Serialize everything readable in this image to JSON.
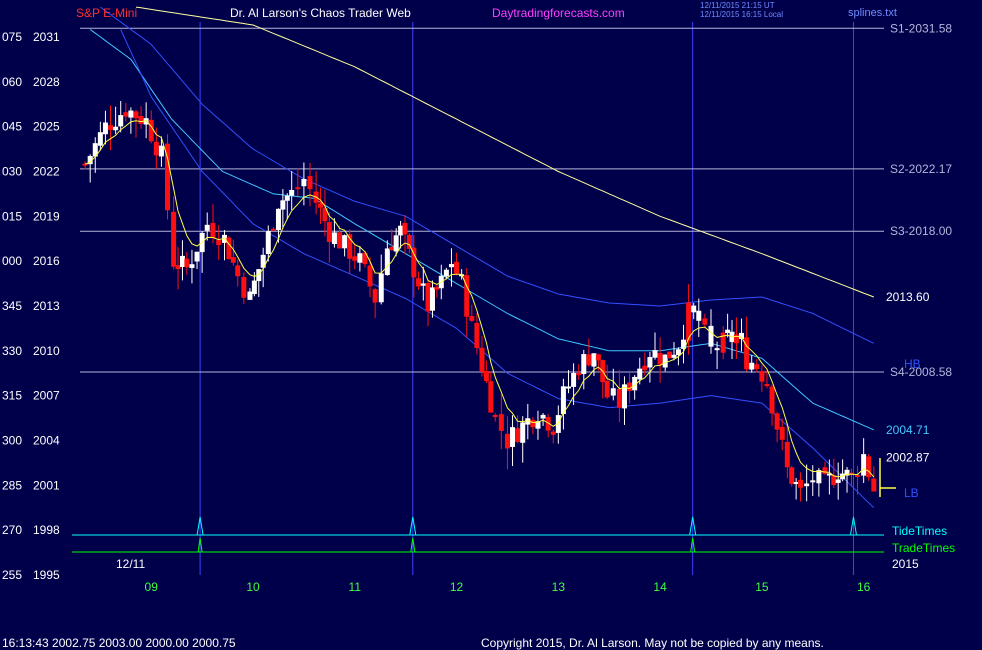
{
  "header": {
    "symbol": "S&P E-Mini",
    "site_title": "Dr. Al Larson's Chaos Trader Web",
    "website": "Daytradingforecasts.com",
    "timestamp_utc": "12/11/2015 21:15 UT",
    "timestamp_local": "12/11/2015 16:15 Local",
    "file": "splines.txt"
  },
  "footer": {
    "quote": "16:13:43  2002.75 2003.00 2000.00 2000.75",
    "copyright": "Copyright 2015, Dr. Al Larson. May not be copied by any means."
  },
  "labels": {
    "date": "12/11",
    "year": "2015",
    "tide_times": "TideTimes",
    "trade_times": "TradeTimes",
    "hb": "HB",
    "lb": "LB"
  },
  "colors": {
    "background": "#00004a",
    "up_candle": "#ffffff",
    "down_candle": "#ff1010",
    "ema_fast": "#ffff40",
    "ema_slow": "#ffffa0",
    "band_mid": "#40c8ff",
    "band_outer": "#3050ff",
    "levels": "#b4b4dc",
    "time_grid": "#4040ff",
    "tide": "#00ffff",
    "trade": "#00ff00"
  },
  "chart_data": {
    "type": "candlestick",
    "x_label": "hour",
    "xlim": [
      8.3,
      16.2
    ],
    "ylim": [
      1995,
      2032
    ],
    "x_ticks": [
      "09",
      "10",
      "11",
      "12",
      "13",
      "14",
      "15",
      "16"
    ],
    "y_ticks": [
      {
        "left": "255",
        "value": "1995"
      },
      {
        "left": "270",
        "value": "1998"
      },
      {
        "left": "285",
        "value": "2001"
      },
      {
        "left": "300",
        "value": "2004"
      },
      {
        "left": "315",
        "value": "2007"
      },
      {
        "left": "330",
        "value": "2010"
      },
      {
        "left": "345",
        "value": "2013"
      },
      {
        "left": "000",
        "value": "2016"
      },
      {
        "left": "015",
        "value": "2019"
      },
      {
        "left": "030",
        "value": "2022"
      },
      {
        "left": "045",
        "value": "2025"
      },
      {
        "left": "060",
        "value": "2028"
      },
      {
        "left": "075",
        "value": "2031"
      }
    ],
    "levels": [
      {
        "label": "S1-2031.58",
        "value": 2031.58
      },
      {
        "label": "S2-2022.17",
        "value": 2022.17
      },
      {
        "label": "S3-2018.00",
        "value": 2018.0
      },
      {
        "label": "S4-2008.58",
        "value": 2008.58
      }
    ],
    "line_labels": [
      {
        "label": "2013.60",
        "value": 2013.6
      },
      {
        "label": "2004.71",
        "value": 2004.71
      },
      {
        "label": "2002.87",
        "value": 2002.87
      }
    ],
    "time_lines": [
      9.48,
      11.57,
      14.32,
      15.9
    ],
    "tide_times": [
      9.48,
      11.57,
      14.32,
      15.9
    ],
    "trade_times": [
      9.48,
      11.57,
      14.32
    ],
    "price_path": [
      [
        8.35,
        2022.5
      ],
      [
        8.55,
        2025.0
      ],
      [
        8.75,
        2026.2
      ],
      [
        8.95,
        2025.4
      ],
      [
        9.1,
        2023.0
      ],
      [
        9.22,
        2016.0
      ],
      [
        9.35,
        2015.5
      ],
      [
        9.55,
        2018.5
      ],
      [
        9.72,
        2017.5
      ],
      [
        9.85,
        2015.0
      ],
      [
        9.97,
        2013.5
      ],
      [
        10.1,
        2016.5
      ],
      [
        10.25,
        2020.0
      ],
      [
        10.38,
        2020.5
      ],
      [
        10.5,
        2021.5
      ],
      [
        10.62,
        2020.0
      ],
      [
        10.75,
        2018.0
      ],
      [
        10.9,
        2017.0
      ],
      [
        11.05,
        2016.0
      ],
      [
        11.2,
        2013.5
      ],
      [
        11.32,
        2017.0
      ],
      [
        11.45,
        2018.0
      ],
      [
        11.58,
        2015.5
      ],
      [
        11.72,
        2013.0
      ],
      [
        11.85,
        2014.5
      ],
      [
        11.95,
        2016.0
      ],
      [
        12.05,
        2014.5
      ],
      [
        12.15,
        2011.5
      ],
      [
        12.25,
        2009.0
      ],
      [
        12.38,
        2005.5
      ],
      [
        12.5,
        2004.0
      ],
      [
        12.65,
        2005.0
      ],
      [
        12.8,
        2006.0
      ],
      [
        12.95,
        2005.0
      ],
      [
        13.05,
        2007.0
      ],
      [
        13.2,
        2009.0
      ],
      [
        13.35,
        2010.0
      ],
      [
        13.48,
        2007.0
      ],
      [
        13.6,
        2006.5
      ],
      [
        13.75,
        2008.5
      ],
      [
        13.9,
        2010.0
      ],
      [
        14.05,
        2009.5
      ],
      [
        14.18,
        2010.5
      ],
      [
        14.28,
        2012.5
      ],
      [
        14.38,
        2012.0
      ],
      [
        14.5,
        2010.0
      ],
      [
        14.62,
        2010.5
      ],
      [
        14.75,
        2011.0
      ],
      [
        14.85,
        2009.5
      ],
      [
        14.95,
        2009.0
      ],
      [
        15.05,
        2008.0
      ],
      [
        15.15,
        2005.0
      ],
      [
        15.25,
        2002.0
      ],
      [
        15.38,
        2000.5
      ],
      [
        15.5,
        2001.5
      ],
      [
        15.62,
        2001.0
      ],
      [
        15.75,
        2002.0
      ],
      [
        15.88,
        2001.5
      ],
      [
        16.0,
        2003.0
      ],
      [
        16.1,
        2000.75
      ]
    ],
    "overlays": [
      {
        "name": "slow",
        "points": [
          [
            8.85,
            2033
          ],
          [
            10.0,
            2031.8
          ],
          [
            11.0,
            2029.0
          ],
          [
            12.0,
            2025.5
          ],
          [
            13.0,
            2022.0
          ],
          [
            14.0,
            2019.0
          ],
          [
            15.0,
            2016.5
          ],
          [
            16.1,
            2013.6
          ]
        ]
      },
      {
        "name": "band_top",
        "points": [
          [
            8.5,
            2033
          ],
          [
            9.0,
            2030.5
          ],
          [
            9.5,
            2026.5
          ],
          [
            10.0,
            2023.5
          ],
          [
            10.5,
            2021.5
          ],
          [
            11.0,
            2020.0
          ],
          [
            11.5,
            2019.0
          ],
          [
            12.0,
            2017.0
          ],
          [
            12.5,
            2015.0
          ],
          [
            13.0,
            2013.8
          ],
          [
            13.5,
            2013.2
          ],
          [
            14.0,
            2013.0
          ],
          [
            14.5,
            2013.4
          ],
          [
            15.0,
            2013.6
          ],
          [
            15.5,
            2012.5
          ],
          [
            16.1,
            2010.5
          ]
        ]
      },
      {
        "name": "band_mid",
        "points": [
          [
            8.4,
            2031.5
          ],
          [
            8.8,
            2029.5
          ],
          [
            9.2,
            2025.5
          ],
          [
            9.7,
            2022.0
          ],
          [
            10.2,
            2020.5
          ],
          [
            10.6,
            2020.2
          ],
          [
            11.0,
            2018.5
          ],
          [
            11.5,
            2016.5
          ],
          [
            12.0,
            2014.5
          ],
          [
            12.5,
            2012.5
          ],
          [
            13.0,
            2010.8
          ],
          [
            13.5,
            2010.0
          ],
          [
            14.0,
            2010.0
          ],
          [
            14.5,
            2010.5
          ],
          [
            15.0,
            2009.5
          ],
          [
            15.5,
            2006.5
          ],
          [
            16.1,
            2004.71
          ]
        ]
      },
      {
        "name": "band_bot",
        "points": [
          [
            8.7,
            2031.5
          ],
          [
            9.0,
            2027.0
          ],
          [
            9.5,
            2022.0
          ],
          [
            10.0,
            2018.5
          ],
          [
            10.5,
            2016.5
          ],
          [
            11.0,
            2015.0
          ],
          [
            11.5,
            2013.5
          ],
          [
            12.0,
            2011.5
          ],
          [
            12.5,
            2008.5
          ],
          [
            13.0,
            2006.8
          ],
          [
            13.5,
            2006.2
          ],
          [
            14.0,
            2006.5
          ],
          [
            14.5,
            2007.0
          ],
          [
            15.0,
            2006.5
          ],
          [
            15.5,
            2003.5
          ],
          [
            16.1,
            1999.5
          ]
        ]
      }
    ]
  }
}
